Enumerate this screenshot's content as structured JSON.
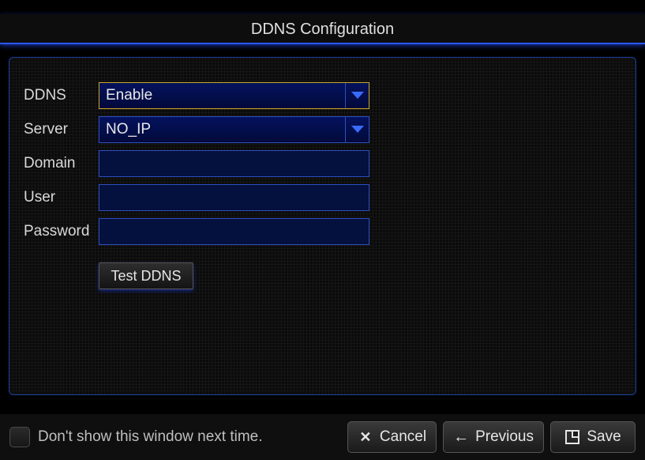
{
  "title": "DDNS Configuration",
  "form": {
    "ddns": {
      "label": "DDNS",
      "value": "Enable"
    },
    "server": {
      "label": "Server",
      "value": "NO_IP"
    },
    "domain": {
      "label": "Domain",
      "value": ""
    },
    "user": {
      "label": "User",
      "value": ""
    },
    "password": {
      "label": "Password",
      "value": ""
    },
    "test_label": "Test DDNS"
  },
  "footer": {
    "dont_show_label": "Don't show this window next time.",
    "dont_show_checked": false,
    "cancel": "Cancel",
    "previous": "Previous",
    "save": "Save"
  }
}
